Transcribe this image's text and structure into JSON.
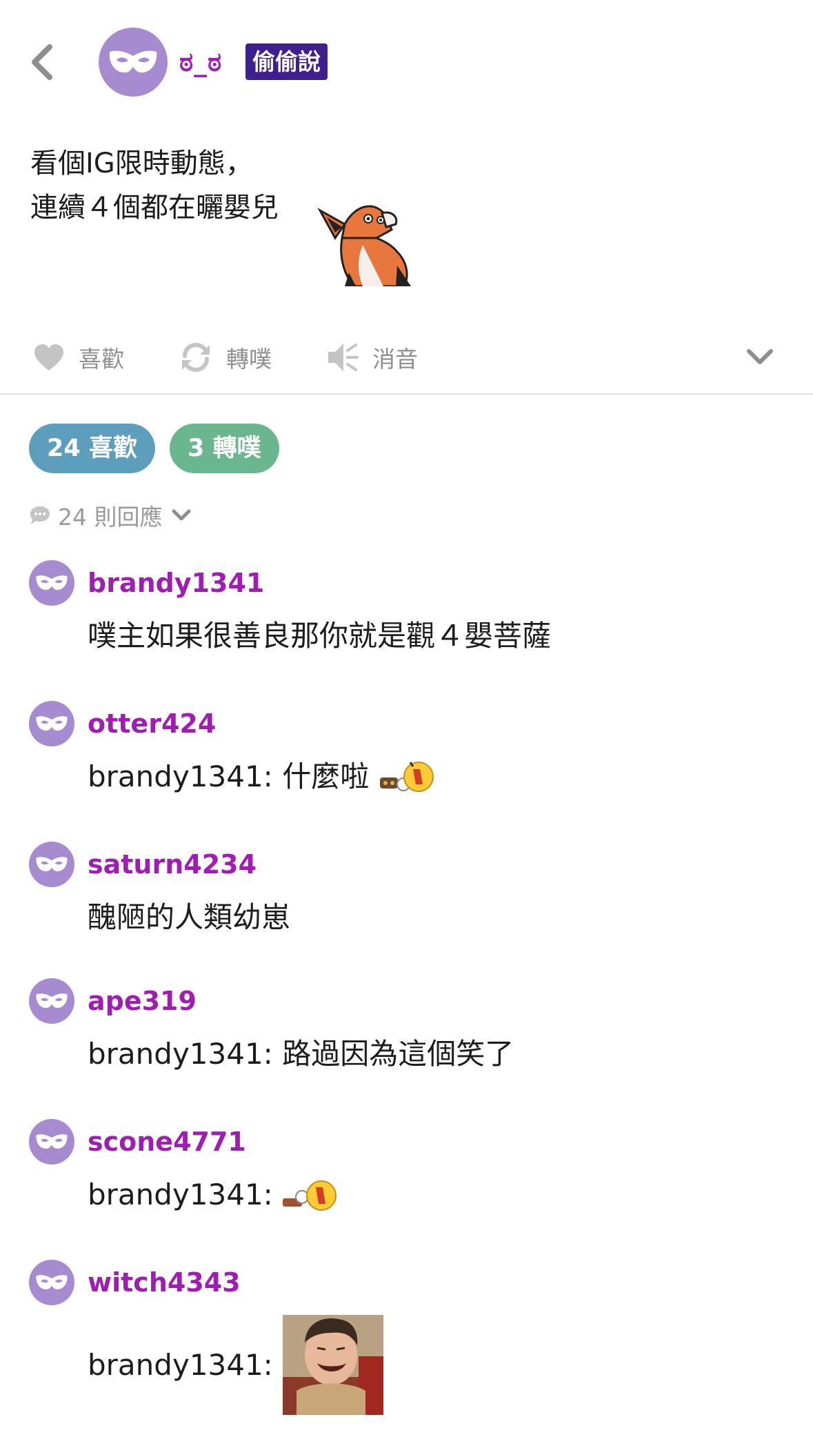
{
  "header": {
    "username": "ಠ_ಠ",
    "badge": "偷偷說"
  },
  "post": {
    "line1": "看個IG限時動態，",
    "line2": "連續４個都在曬嬰兒"
  },
  "actions": {
    "like": "喜歡",
    "replurk": "轉噗",
    "mute": "消音"
  },
  "stats": {
    "likes": "24 喜歡",
    "replurks": "3 轉噗",
    "responses": "24 則回應"
  },
  "comments": [
    {
      "name": "brandy1341",
      "text": "噗主如果很善良那你就是觀４嬰菩薩"
    },
    {
      "name": "otter424",
      "text": "brandy1341: 什麼啦"
    },
    {
      "name": "saturn4234",
      "text": "醜陋的人類幼崽"
    },
    {
      "name": "ape319",
      "text": "brandy1341: 路過因為這個笑了"
    },
    {
      "name": "scone4771",
      "text": "brandy1341:"
    },
    {
      "name": "witch4343",
      "text": "brandy1341:"
    }
  ],
  "colors": {
    "avatar": "#a78bd1",
    "username": "#a11cb5",
    "badge": "#3f1f8c",
    "like_pill": "#5e9ebd",
    "replurk_pill": "#6ab78f"
  }
}
